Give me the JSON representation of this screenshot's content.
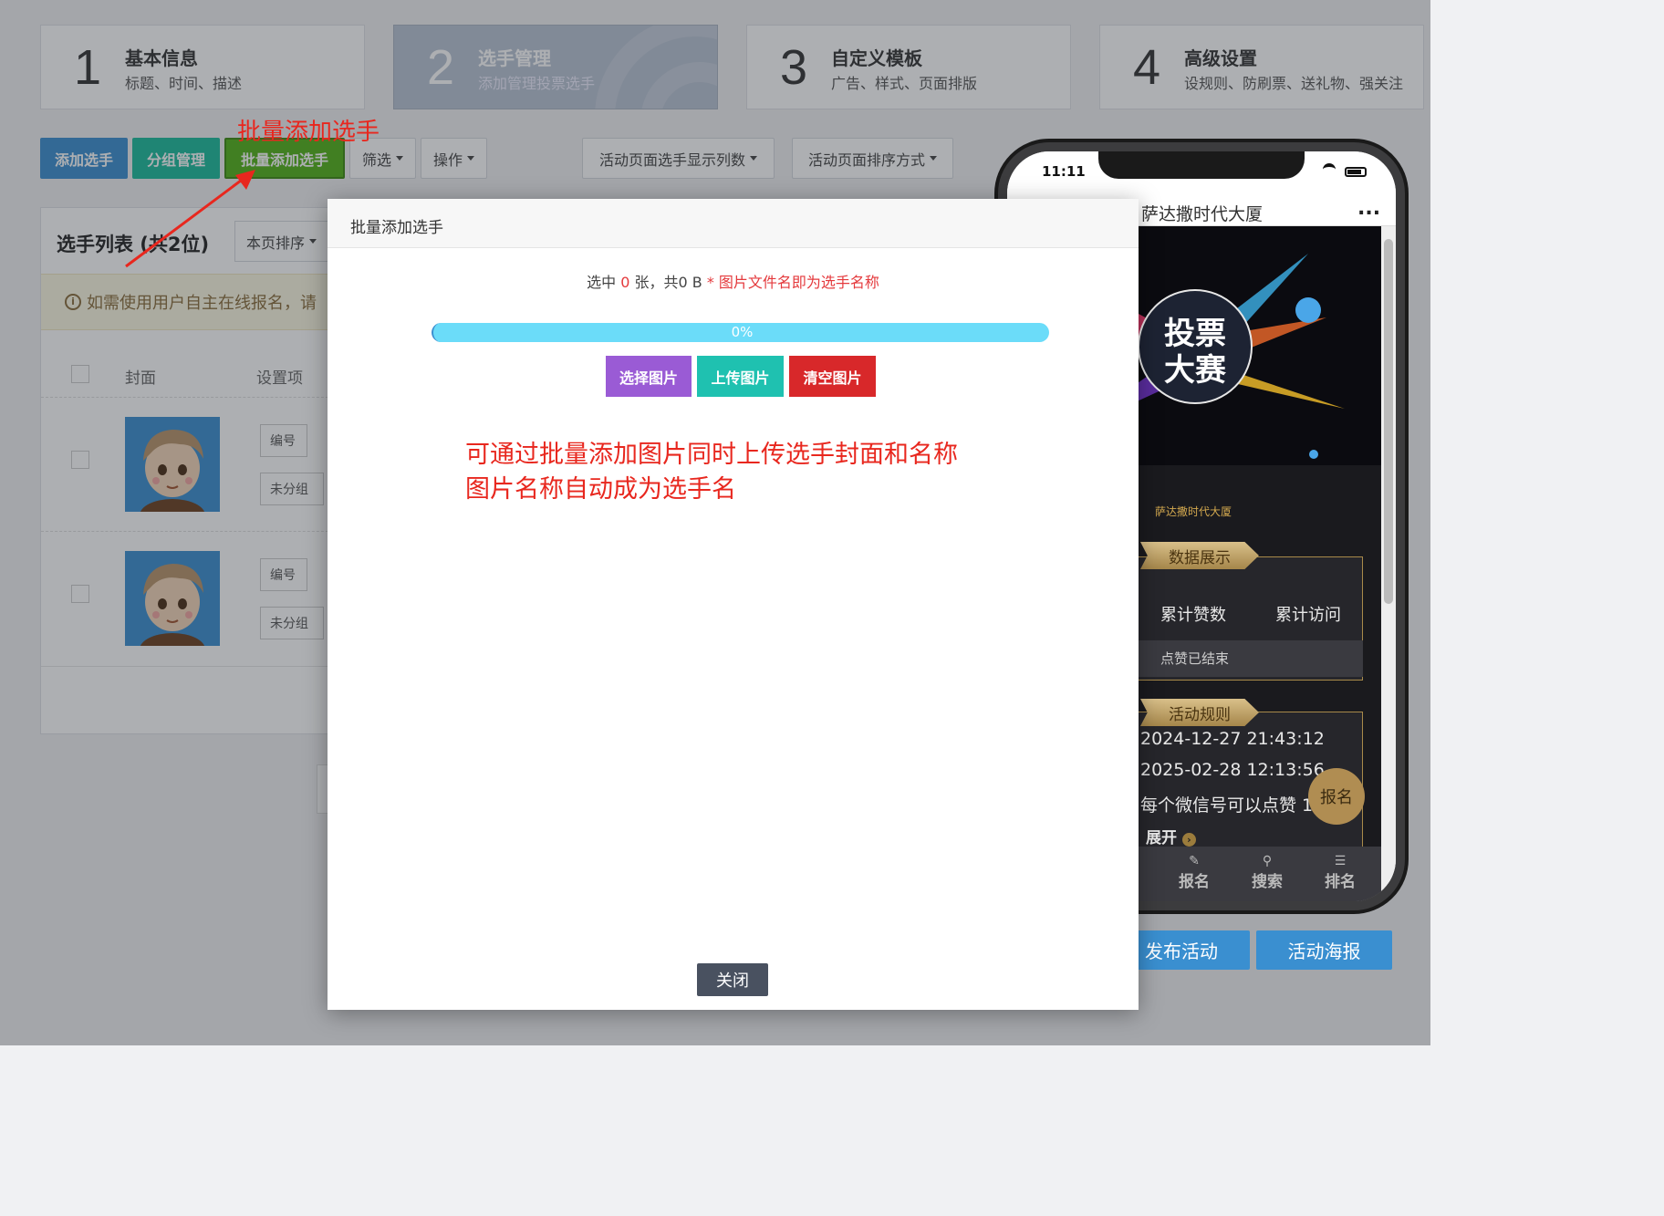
{
  "steps": [
    {
      "num": "1",
      "title": "基本信息",
      "sub": "标题、时间、描述"
    },
    {
      "num": "2",
      "title": "选手管理",
      "sub": "添加管理投票选手"
    },
    {
      "num": "3",
      "title": "自定义模板",
      "sub": "广告、样式、页面排版"
    },
    {
      "num": "4",
      "title": "高级设置",
      "sub": "设规则、防刷票、送礼物、强关注"
    }
  ],
  "toolbar": {
    "add": "添加选手",
    "group": "分组管理",
    "batch": "批量添加选手",
    "filter": "筛选",
    "ops": "操作",
    "cols": "活动页面选手显示列数",
    "sort": "活动页面排序方式"
  },
  "annotation": {
    "label": "批量添加选手",
    "line1": "可通过批量添加图片同时上传选手封面和名称",
    "line2": "图片名称自动成为选手名"
  },
  "list": {
    "title": "选手列表 (共2位)",
    "page_sort": "本页排序",
    "notice": "如需使用用户自主在线报名，请",
    "col_cover": "封面",
    "col_settings": "设置项",
    "rows": [
      {
        "tag1": "编号",
        "tag2": "未分组"
      },
      {
        "tag1": "编号",
        "tag2": "未分组"
      }
    ]
  },
  "modal": {
    "title": "批量添加选手",
    "info_prefix": "选中",
    "info_count": "0",
    "info_mid": "张，共0 B",
    "info_note": "* 图片文件名即为选手名称",
    "progress_label": "0%",
    "progress": 0,
    "choose": "选择图片",
    "upload": "上传图片",
    "clear": "清空图片",
    "close": "关闭"
  },
  "phone": {
    "time": "11:11",
    "title": "萨达撒时代大厦",
    "more": "...",
    "banner_line1": "投票",
    "banner_line2": "大赛",
    "venue": "萨达撒时代大厦",
    "data_section": "数据展示",
    "stat1": "累计赞数",
    "stat2": "累计访问",
    "ended": "点赞已结束",
    "rules_section": "活动规则",
    "start": "2024-12-27 21:43:12",
    "end": "2025-02-28 12:13:56",
    "rule": "每个微信号可以点赞 1",
    "expand": "展开",
    "signup_bubble": "报名",
    "nav": [
      "报名",
      "搜索",
      "排名"
    ]
  },
  "bottom": {
    "publish": "发布活动",
    "poster": "活动海报"
  },
  "colors": {
    "blue": "#3a8fd0",
    "teal": "#1abc9c",
    "green": "#52b218",
    "purple": "#9a5bd5",
    "upload_teal": "#1fc1b0",
    "clear_red": "#d8282a",
    "progress": "#6bdcf9",
    "annot_red": "#e8271e"
  }
}
